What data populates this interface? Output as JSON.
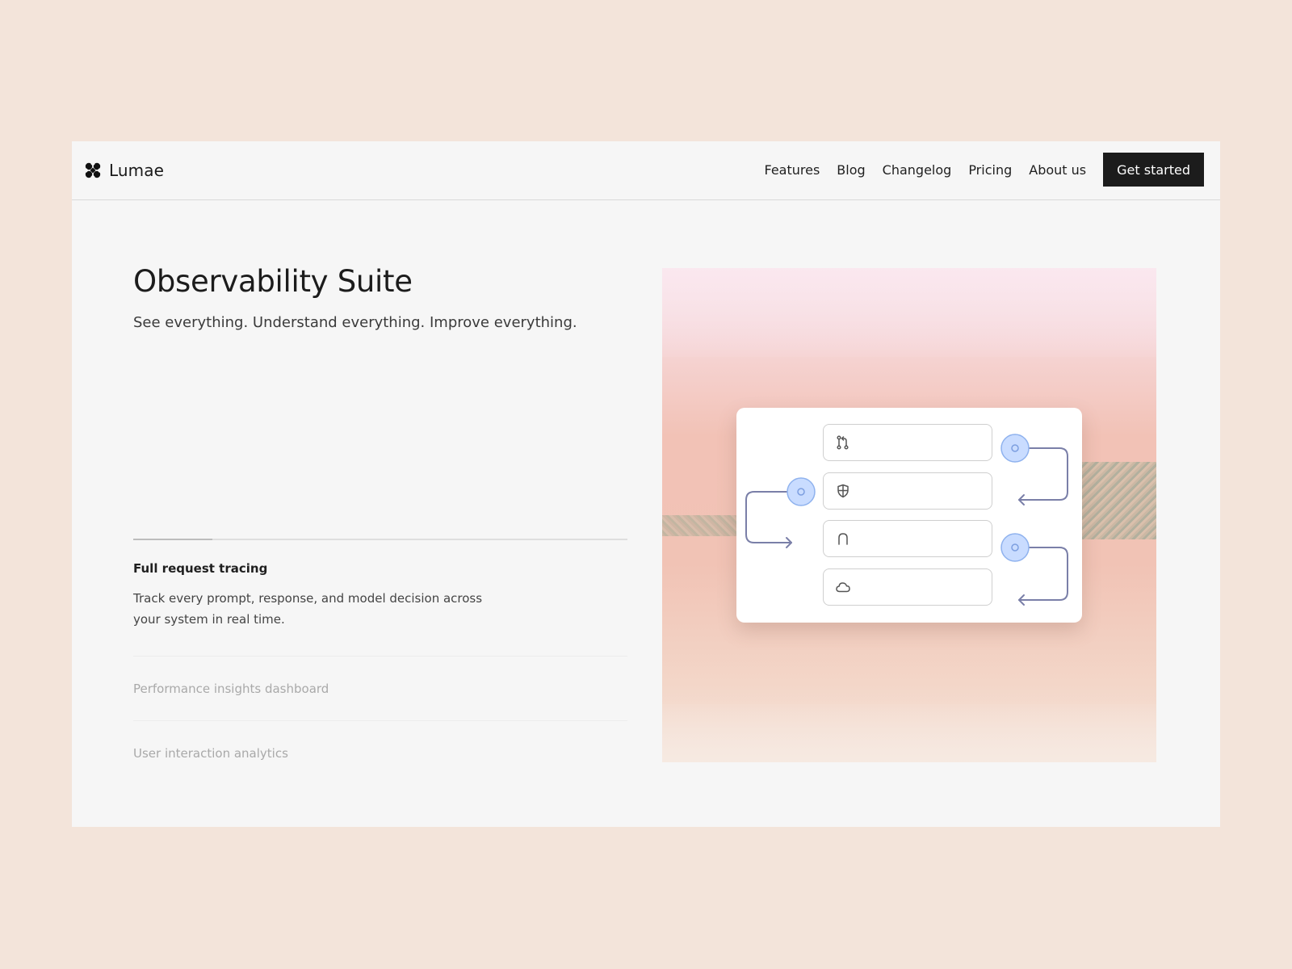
{
  "brand": {
    "name": "Lumae",
    "icon": "four-petal-logo-icon"
  },
  "nav": {
    "links": [
      "Features",
      "Blog",
      "Changelog",
      "Pricing",
      "About us"
    ],
    "cta_label": "Get started"
  },
  "hero": {
    "title": "Observability Suite",
    "subtitle": "See everything. Understand everything. Improve everything."
  },
  "features": {
    "progress": 0.16,
    "active": {
      "title": "Full request tracing",
      "description": "Track every prompt, response, and model decision across your system in real time."
    },
    "items": [
      "Performance insights dashboard",
      "User interaction analytics"
    ]
  },
  "illustration": {
    "fields": [
      "git-pull-request-icon",
      "shield-icon",
      "magnet-icon",
      "cloud-icon"
    ],
    "colors": {
      "node": "#c9dcff",
      "node_border": "#8fb2ee",
      "line": "#7a7fa8"
    }
  }
}
